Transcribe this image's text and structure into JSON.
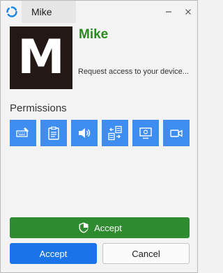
{
  "window": {
    "title": "Mike"
  },
  "peer": {
    "avatar_letter": "M",
    "name": "Mike",
    "request_text": "Request access to your device..."
  },
  "permissions": {
    "label": "Permissions",
    "items": [
      {
        "name": "keyboard-icon"
      },
      {
        "name": "clipboard-icon"
      },
      {
        "name": "audio-icon"
      },
      {
        "name": "file-transfer-icon"
      },
      {
        "name": "remote-desktop-icon"
      },
      {
        "name": "camera-icon"
      }
    ]
  },
  "buttons": {
    "accept_secure_label": "Accept",
    "accept_label": "Accept",
    "cancel_label": "Cancel"
  },
  "colors": {
    "name_green": "#2a8a1f",
    "permission_blue": "#3d8ef0",
    "accept_green": "#2e8b2f",
    "accept_blue": "#1a73e8"
  }
}
